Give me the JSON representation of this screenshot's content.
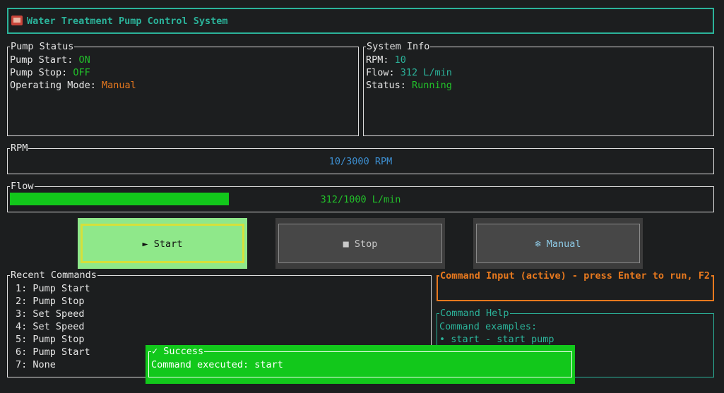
{
  "header": {
    "title": "Water Treatment Pump Control System",
    "icon": "factory-icon"
  },
  "pump_status": {
    "title": "Pump Status",
    "start_label": "Pump Start: ",
    "start_value": "ON",
    "stop_label": "Pump Stop: ",
    "stop_value": "OFF",
    "mode_label": "Operating Mode: ",
    "mode_value": "Manual"
  },
  "system_info": {
    "title": "System Info",
    "rpm_label": "RPM: ",
    "rpm_value": "10",
    "flow_label": "Flow: ",
    "flow_value": "312 L/min",
    "status_label": "Status: ",
    "status_value": "Running"
  },
  "rpm_gauge": {
    "title": "RPM",
    "text": "10/3000 RPM",
    "fraction": 0.0033
  },
  "flow_gauge": {
    "title": "Flow",
    "text": "312/1000 L/min",
    "fraction": 0.312
  },
  "buttons": {
    "start": "► Start",
    "stop": "■ Stop",
    "manual": "❄ Manual"
  },
  "recent": {
    "title": "Recent Commands",
    "items": [
      "1: Pump Start",
      "2: Pump Stop",
      "3: Set Speed",
      "4: Set Speed",
      "5: Pump Stop",
      "6: Pump Start",
      "7: None"
    ]
  },
  "command_input": {
    "title": "Command Input (active) - press Enter to run, F2",
    "value": ""
  },
  "command_help": {
    "title": "Command Help",
    "lines": [
      "Command examples:",
      "• start - start pump"
    ]
  },
  "toast": {
    "title": "✓ Success",
    "message": "Command executed: start"
  },
  "colors": {
    "accent": "#2bb39a",
    "on": "#22c02a",
    "warning": "#e8791e",
    "info": "#3d8fd1",
    "success_bg": "#12c81b",
    "start_button": "#8fe88a"
  }
}
